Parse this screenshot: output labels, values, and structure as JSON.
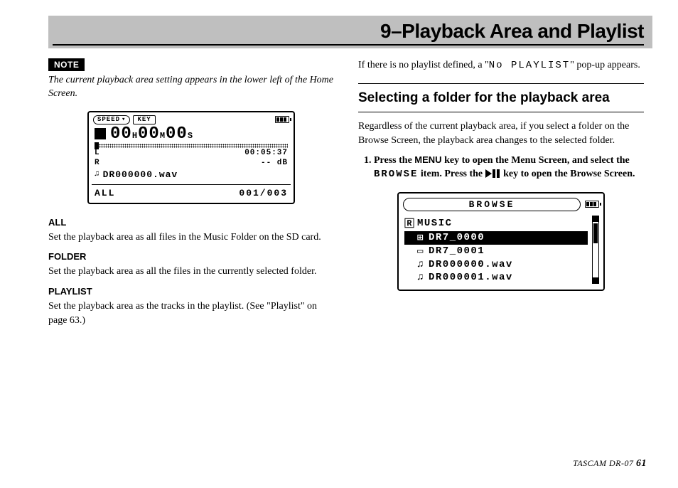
{
  "title": "9–Playback Area and Playlist",
  "left": {
    "note_badge": "NOTE",
    "note_text": "The current playback area setting appears in the lower left of the Home Screen.",
    "lcd": {
      "speed_label": "SPEED",
      "key_label": "KEY",
      "time_h": "00",
      "time_m": "00",
      "time_s": "00",
      "unit_h": "H",
      "unit_m": "M",
      "unit_s": "S",
      "sub_time": "00:05:37",
      "meter_l": "L",
      "meter_r": "R",
      "meter_db": "-- dB",
      "file_icon": "♫",
      "file_name": "DR000000.wav",
      "area_label": "ALL",
      "counter": "001/003"
    },
    "sections": {
      "all_h": "ALL",
      "all_p": "Set the playback area as all files in the Music Folder on the SD card.",
      "folder_h": "FOLDER",
      "folder_p": "Set the playback area as all the files in the currently selected folder.",
      "playlist_h": "PLAYLIST",
      "playlist_p": "Set the playback area as the tracks in the playlist. (See \"Playlist\" on page 63.)"
    }
  },
  "right": {
    "intro_a": "If there is no playlist defined, a \"",
    "intro_mono": "No PLAYLIST",
    "intro_b": "\" pop-up appears.",
    "h2": "Selecting a folder for the playback area",
    "para": "Regardless of the current playback area, if you select a folder on the Browse Screen, the playback area changes to the selected folder.",
    "step1_a": "Press the ",
    "step1_menu": "MENU",
    "step1_b": " key to open the Menu Screen, and select the ",
    "step1_browse": "BROWSE",
    "step1_c": " item. Press the ",
    "step1_d": " key to open the Browse Screen.",
    "lcd2": {
      "title": "BROWSE",
      "root_icon": "🅁",
      "root": "MUSIC",
      "rows": [
        {
          "icon": "⊞",
          "name": "DR7_0000",
          "selected": true
        },
        {
          "icon": "▭",
          "name": "DR7_0001",
          "selected": false
        },
        {
          "icon": "♫",
          "name": "DR000000.wav",
          "selected": false
        },
        {
          "icon": "♫",
          "name": "DR000001.wav",
          "selected": false
        }
      ]
    }
  },
  "footer": {
    "label": "TASCAM  DR-07 ",
    "page": "61"
  }
}
